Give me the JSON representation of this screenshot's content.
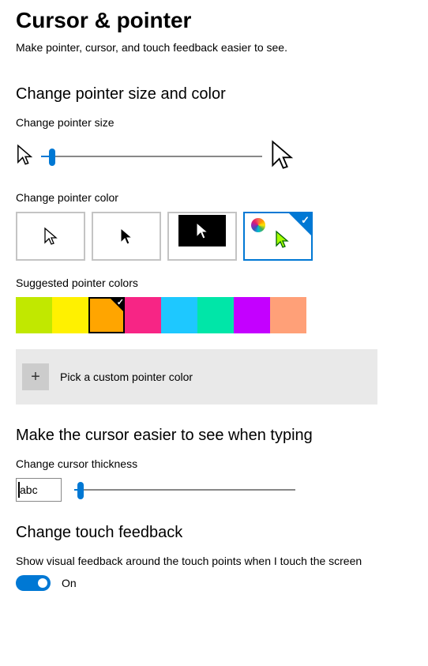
{
  "title": "Cursor & pointer",
  "subtitle": "Make pointer, cursor, and touch feedback easier to see.",
  "sections": {
    "size_color_heading": "Change pointer size and color",
    "size_label": "Change pointer size",
    "size_slider_percent": 5,
    "color_label": "Change pointer color",
    "pointer_color_options": [
      {
        "id": "white-cursor",
        "selected": false
      },
      {
        "id": "black-cursor",
        "selected": false
      },
      {
        "id": "inverted-cursor",
        "selected": false
      },
      {
        "id": "custom-color-cursor",
        "selected": true
      }
    ],
    "suggested_label": "Suggested pointer colors",
    "suggested_colors": [
      {
        "hex": "#c1e800",
        "selected": false
      },
      {
        "hex": "#fff100",
        "selected": false
      },
      {
        "hex": "#ffa500",
        "selected": true
      },
      {
        "hex": "#f72585",
        "selected": false
      },
      {
        "hex": "#1ec8ff",
        "selected": false
      },
      {
        "hex": "#00e6a8",
        "selected": false
      },
      {
        "hex": "#c400ff",
        "selected": false
      },
      {
        "hex": "#ffa078",
        "selected": false
      }
    ],
    "custom_color_label": "Pick a custom pointer color",
    "cursor_heading": "Make the cursor easier to see when typing",
    "thickness_label": "Change cursor thickness",
    "thickness_preview_text": "abc",
    "thickness_slider_percent": 3,
    "touch_heading": "Change touch feedback",
    "touch_label": "Show visual feedback around the touch points when I touch the screen",
    "touch_toggle_on": true,
    "touch_toggle_text": "On"
  }
}
